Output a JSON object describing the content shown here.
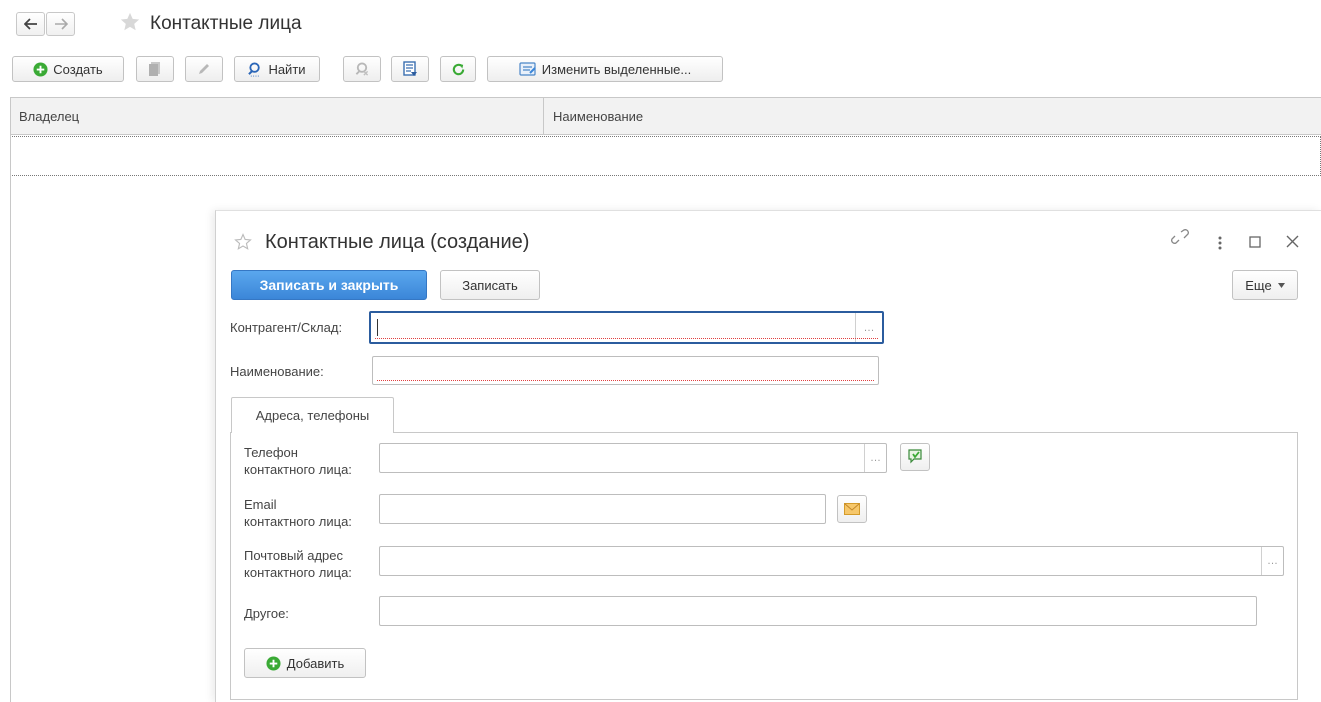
{
  "page": {
    "title": "Контактные лица"
  },
  "toolbar": {
    "create_label": "Создать",
    "find_label": "Найти",
    "change_selected_label": "Изменить выделенные..."
  },
  "list": {
    "columns": [
      "Владелец",
      "Наименование"
    ]
  },
  "modal": {
    "title": "Контактные лица (создание)",
    "save_close_label": "Записать и закрыть",
    "save_label": "Записать",
    "more_label": "Еще",
    "fields": {
      "counterparty_label": "Контрагент/Склад:",
      "name_label": "Наименование:"
    },
    "tab": {
      "label": "Адреса, телефоны",
      "phone_label_1": "Телефон",
      "phone_label_2": "контактного лица:",
      "email_label_1": "Email",
      "email_label_2": "контактного лица:",
      "postal_label_1": "Почтовый адрес",
      "postal_label_2": "контактного лица:",
      "other_label": "Другое:",
      "add_label": "Добавить"
    }
  },
  "icons": {
    "back": "arrow-left-icon",
    "forward": "arrow-right-icon",
    "favorite": "star-icon",
    "create": "plus-circle-icon",
    "copy": "copy-icon",
    "edit": "pencil-icon",
    "find": "search-icon",
    "cancel_search": "search-cancel-icon",
    "filter": "filter-icon",
    "refresh": "refresh-icon",
    "group_edit": "group-edit-icon",
    "link": "link-icon",
    "menu": "kebab-icon",
    "maximize": "maximize-icon",
    "close": "close-icon",
    "phone_call": "phone-icon",
    "mail": "envelope-icon"
  },
  "colors": {
    "primary": "#4a97e6",
    "focus": "#2b5c9e",
    "invalid": "#e04040",
    "create_green": "#3aaa35"
  }
}
